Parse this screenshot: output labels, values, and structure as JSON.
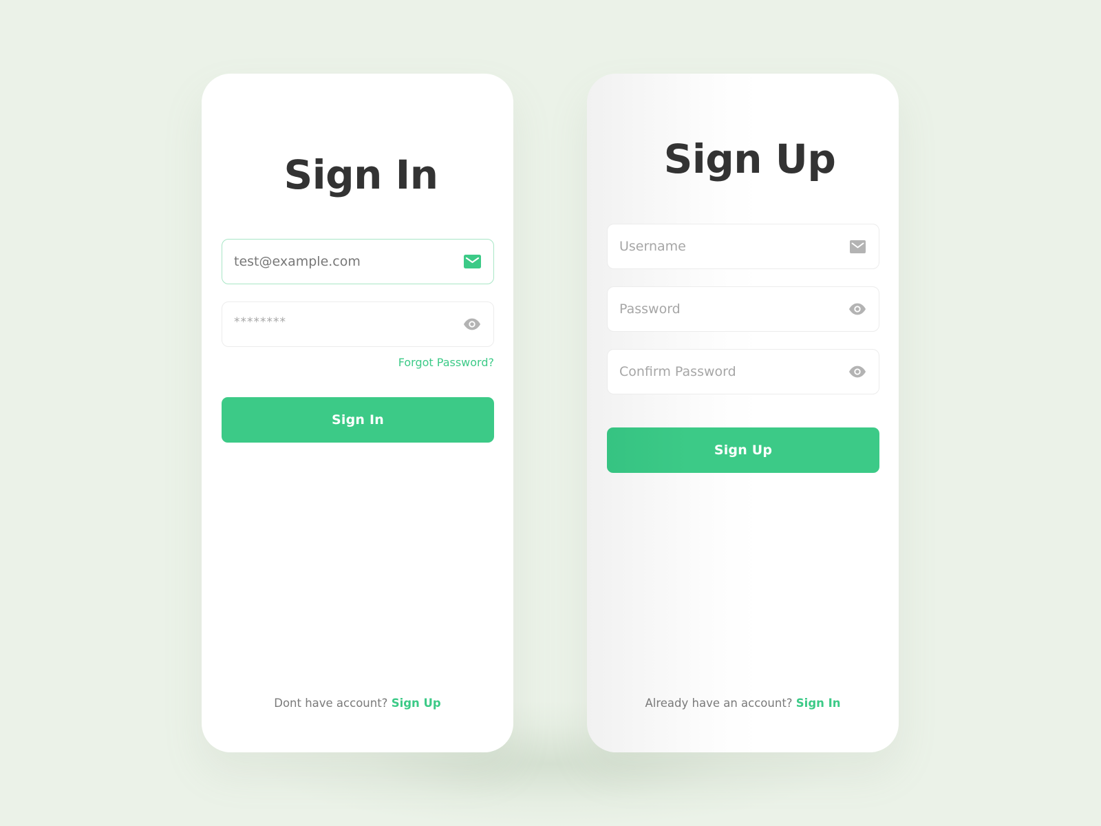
{
  "colors": {
    "background": "#ebf2e8",
    "accent": "#3cca87",
    "title": "#333333",
    "muted_text": "#7a7a7a",
    "placeholder": "#a6a6a6",
    "icon_inactive": "#b3b3b3"
  },
  "sign_in": {
    "title": "Sign In",
    "email": {
      "value": "test@example.com",
      "placeholder": "",
      "icon": "mail-icon"
    },
    "password": {
      "value": "",
      "placeholder": "********",
      "icon": "eye-icon"
    },
    "forgot_password_label": "Forgot Password?",
    "submit_label": "Sign In",
    "footer_text": "Dont have account?",
    "footer_link": "Sign Up"
  },
  "sign_up": {
    "title": "Sign Up",
    "username": {
      "value": "",
      "placeholder": "Username",
      "icon": "mail-icon"
    },
    "password": {
      "value": "",
      "placeholder": "Password",
      "icon": "eye-icon"
    },
    "confirm_password": {
      "value": "",
      "placeholder": "Confirm Password",
      "icon": "eye-icon"
    },
    "submit_label": "Sign Up",
    "footer_text": "Already have an account?",
    "footer_link": "Sign In"
  }
}
